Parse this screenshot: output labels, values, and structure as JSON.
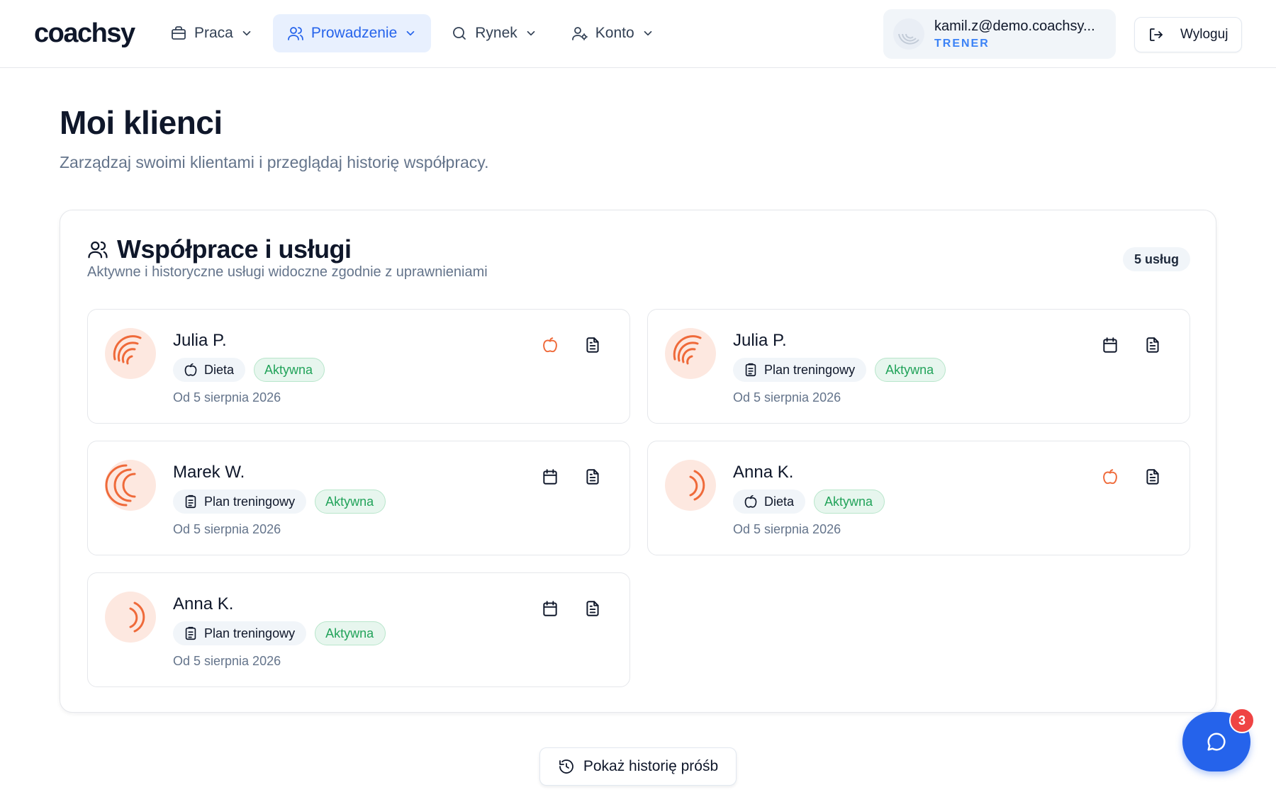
{
  "app": {
    "logo": "coachsy"
  },
  "nav": [
    {
      "label": "Praca",
      "icon": "briefcase-icon",
      "active": false
    },
    {
      "label": "Prowadzenie",
      "icon": "users-icon",
      "active": true
    },
    {
      "label": "Rynek",
      "icon": "search-icon",
      "active": false
    },
    {
      "label": "Konto",
      "icon": "user-settings-icon",
      "active": false
    }
  ],
  "user": {
    "email": "kamil.z@demo.coachsy...",
    "role": "TRENER"
  },
  "logout_label": "Wyloguj",
  "page": {
    "title": "Moi klienci",
    "subtitle": "Zarządzaj swoimi klientami i przeglądaj historię współpracy."
  },
  "panel": {
    "title": "Współprace i usługi",
    "subtitle": "Aktywne i historyczne usługi widoczne zgodnie z uprawnieniami",
    "count_label": "5 usług"
  },
  "cards": [
    {
      "name": "Julia P.",
      "service": "Dieta",
      "service_icon": "apple-icon",
      "status": "Aktywna",
      "since": "Od 5 sierpnia 2026",
      "action1_icon": "apple-icon"
    },
    {
      "name": "Julia P.",
      "service": "Plan treningowy",
      "service_icon": "clipboard-icon",
      "status": "Aktywna",
      "since": "Od 5 sierpnia 2026",
      "action1_icon": "calendar-icon"
    },
    {
      "name": "Marek W.",
      "service": "Plan treningowy",
      "service_icon": "clipboard-icon",
      "status": "Aktywna",
      "since": "Od 5 sierpnia 2026",
      "action1_icon": "calendar-icon"
    },
    {
      "name": "Anna K.",
      "service": "Dieta",
      "service_icon": "apple-icon",
      "status": "Aktywna",
      "since": "Od 5 sierpnia 2026",
      "action1_icon": "apple-icon"
    },
    {
      "name": "Anna K.",
      "service": "Plan treningowy",
      "service_icon": "clipboard-icon",
      "status": "Aktywna",
      "since": "Od 5 sierpnia 2026",
      "action1_icon": "calendar-icon"
    }
  ],
  "history_button": "Pokaż historię próśb",
  "chat": {
    "badge": "3"
  },
  "colors": {
    "accent": "#2563eb",
    "nav_active_bg": "#e8f0fe",
    "status_green": "#22a35a",
    "avatar_orange": "#ef6a3a",
    "badge_red": "#ef4444"
  }
}
